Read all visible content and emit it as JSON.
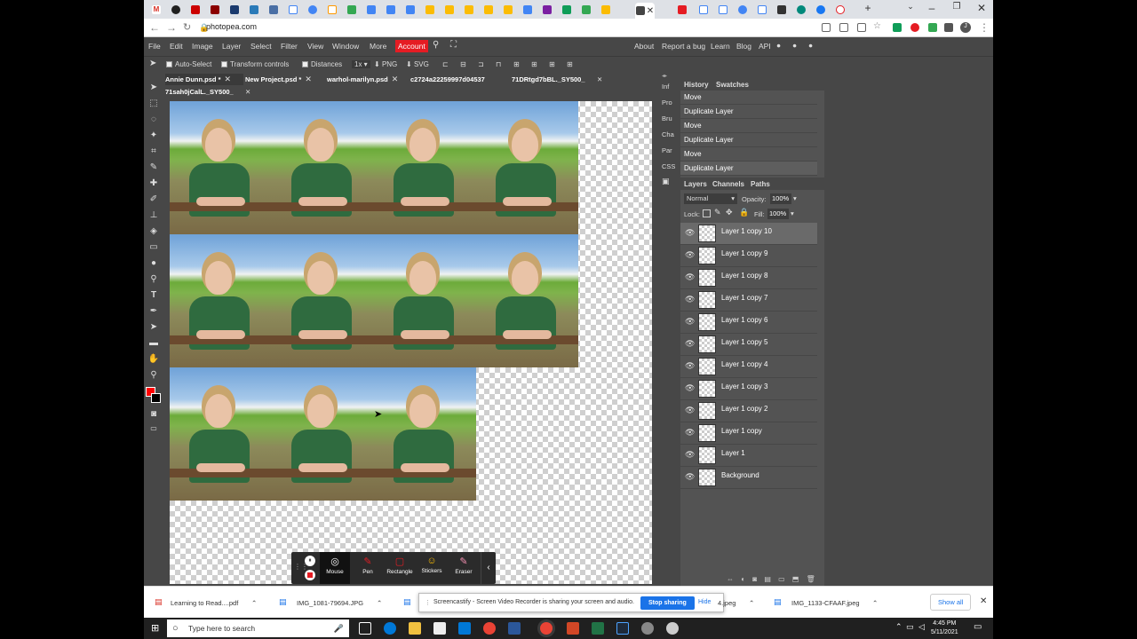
{
  "browser": {
    "url": "photopea.com",
    "tab_icons": [
      "M",
      "●",
      "■",
      "■",
      "■",
      "🌐",
      "SIL",
      "G",
      "🌐",
      "a",
      "▲",
      "▤",
      "▤",
      "▤",
      "■",
      "■",
      "■",
      "▤",
      "▤",
      "▤",
      "■",
      "▲",
      "■"
    ],
    "active_tab_close": "✕",
    "new_tab": "+",
    "profile_initial": "J"
  },
  "menu": {
    "items": [
      "File",
      "Edit",
      "Image",
      "Layer",
      "Select",
      "Filter",
      "View",
      "Window",
      "More"
    ],
    "account": "Account",
    "right_items": [
      "About",
      "Report a bug",
      "Learn",
      "Blog",
      "API"
    ]
  },
  "options": {
    "auto_select": "Auto-Select",
    "transform_controls": "Transform controls",
    "distances": "Distances",
    "zoom": "1x",
    "png": "PNG",
    "svg": "SVG"
  },
  "doc_tabs": [
    "Annie Dunn.psd *",
    "New Project.psd *",
    "warhol-marilyn.psd",
    "c2724a22259997d04537",
    "71DRtgd7bBL._SY500_",
    "71sah0jCalL._SY500_"
  ],
  "dock_labels": [
    "Inf",
    "Pro",
    "Bru",
    "Cha",
    "Par",
    "CSS"
  ],
  "history": {
    "tabs": [
      "History",
      "Swatches"
    ],
    "items": [
      "Move",
      "Duplicate Layer",
      "Move",
      "Duplicate Layer",
      "Move",
      "Duplicate Layer"
    ]
  },
  "layers_panel": {
    "tabs": [
      "Layers",
      "Channels",
      "Paths"
    ],
    "blend_mode": "Normal",
    "opacity_label": "Opacity:",
    "opacity": "100%",
    "lock_label": "Lock:",
    "fill_label": "Fill:",
    "fill": "100%",
    "layers": [
      "Layer 1 copy 10",
      "Layer 1 copy 9",
      "Layer 1 copy 8",
      "Layer 1 copy 7",
      "Layer 1 copy 6",
      "Layer 1 copy 5",
      "Layer 1 copy 4",
      "Layer 1 copy 3",
      "Layer 1 copy 2",
      "Layer 1 copy",
      "Layer 1",
      "Background"
    ],
    "selected_index": 0
  },
  "screencastify": {
    "buttons": [
      "Mouse",
      "Pen",
      "Rectangle",
      "Stickers",
      "Eraser"
    ],
    "share_message": "Screencastify - Screen Video Recorder is sharing your screen and audio.",
    "stop_sharing": "Stop sharing",
    "hide": "Hide"
  },
  "downloads": {
    "items": [
      "Learning to Read....pdf",
      "IMG_1081-79694.JPG",
      "4.jpeg",
      "IMG_1133-CFAAF.jpeg"
    ],
    "show_all": "Show all"
  },
  "taskbar": {
    "search_placeholder": "Type here to search",
    "time": "4:45 PM",
    "date": "5/11/2021"
  },
  "colors": {
    "accent_red": "#e51c23",
    "panel_bg": "#474747",
    "foreground_color": "#ff0000"
  }
}
